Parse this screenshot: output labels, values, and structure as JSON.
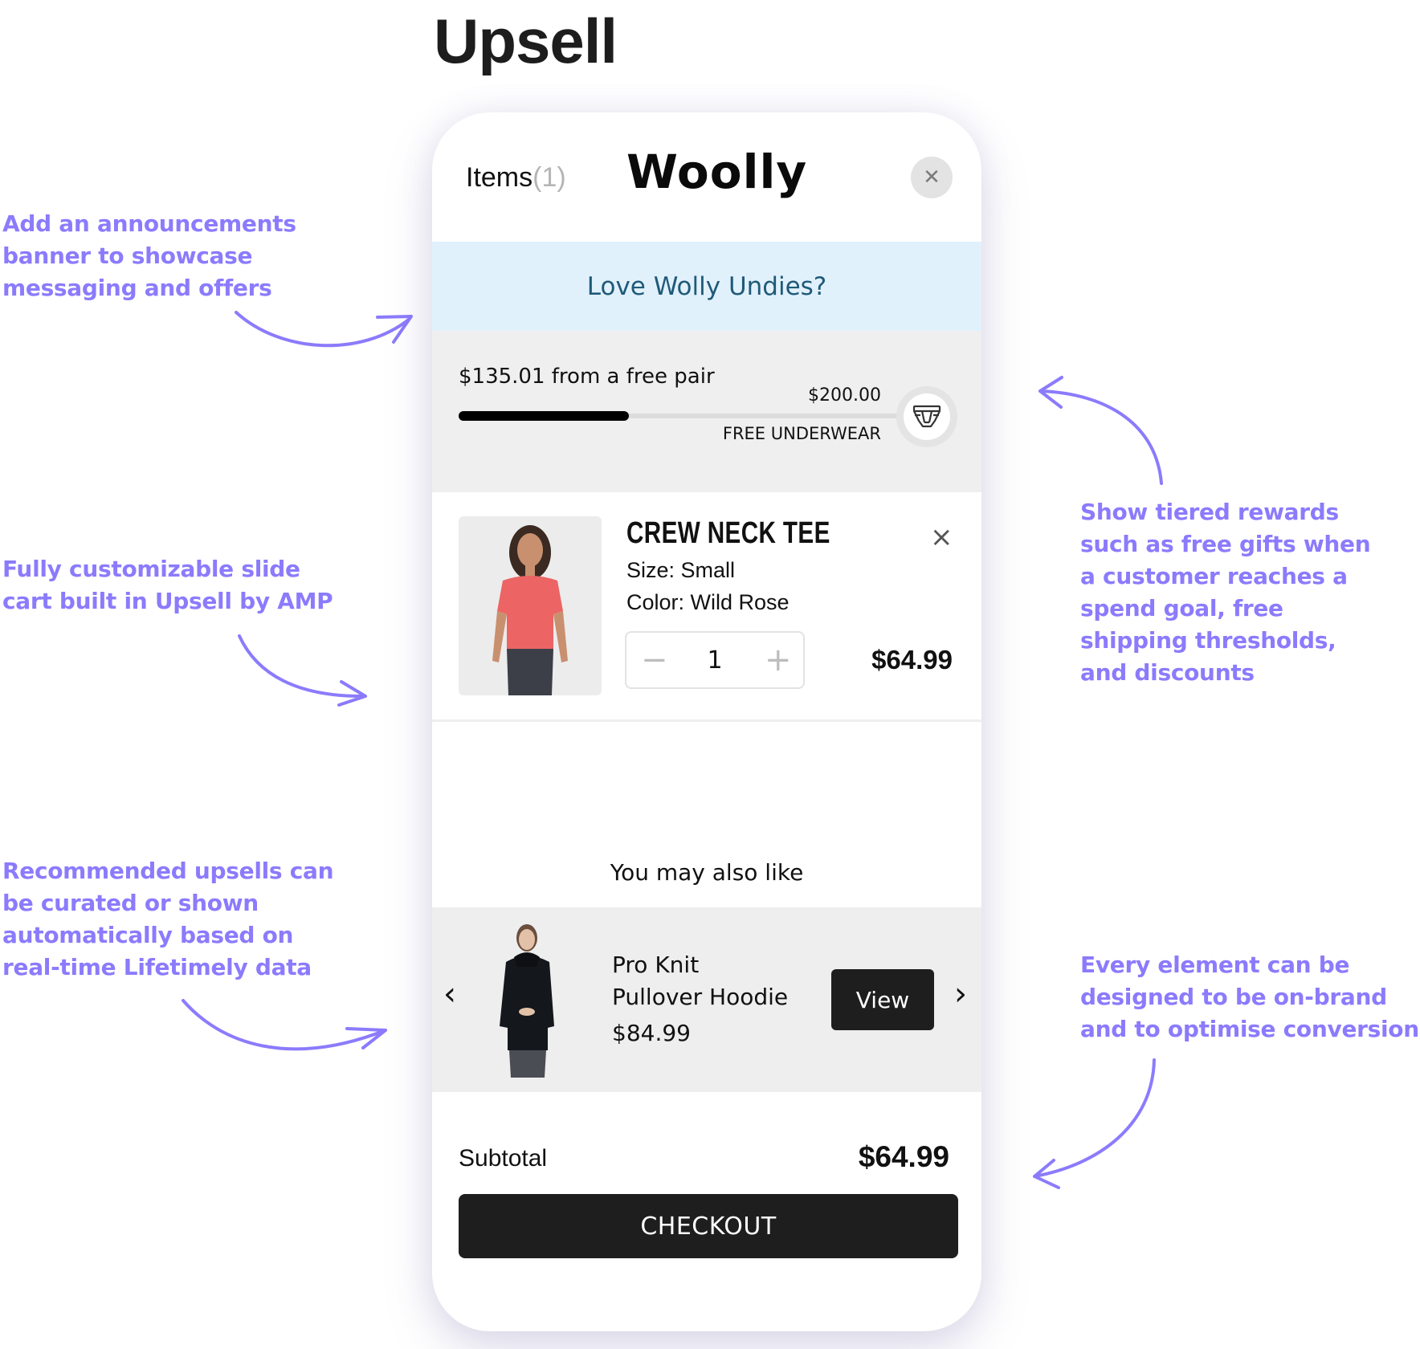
{
  "page": {
    "title": "Upsell"
  },
  "annotations": [
    {
      "id": "announcements",
      "lines": [
        "Add an announcements",
        "banner to showcase",
        "messaging and offers"
      ]
    },
    {
      "id": "slide-cart",
      "lines": [
        "Fully customizable slide",
        "cart built in Upsell by AMP"
      ]
    },
    {
      "id": "upsells",
      "lines": [
        "Recommended upsells can",
        "be curated or shown",
        "automatically based on",
        "real-time Lifetimely data"
      ]
    },
    {
      "id": "tiered-rewards",
      "lines": [
        "Show tiered rewards",
        "such as free gifts when",
        "a customer reaches a",
        "spend goal, free",
        "shipping thresholds,",
        "and discounts"
      ]
    },
    {
      "id": "on-brand",
      "lines": [
        "Every element can be",
        "designed to be on-brand",
        "and to optimise conversion"
      ]
    }
  ],
  "colors": {
    "annotation": "#8b7bfc",
    "banner_bg": "#e1f1fc",
    "banner_text": "#1f5a78",
    "button_dark": "#1e1e1e"
  },
  "cart": {
    "header": {
      "items_label": "Items",
      "items_count": "(1)",
      "brand": "Woolly",
      "close_icon": "close-icon"
    },
    "announcement": {
      "text": "Love Wolly Undies?"
    },
    "rewards": {
      "message": "$135.01 from a free pair",
      "goal": "$200.00",
      "reward_label": "FREE UNDERWEAR",
      "progress_fraction": 0.325,
      "icon": "underwear-icon"
    },
    "line_item": {
      "title": "CREW NECK TEE",
      "size": "Size: Small",
      "color": "Color: Wild Rose",
      "quantity": "1",
      "decrement": "−",
      "increment": "+",
      "price": "$64.99",
      "remove_icon": "×"
    },
    "recommendations": {
      "heading": "You may also like",
      "prev_icon": "‹",
      "next_icon": "›",
      "item": {
        "name_line1": "Pro Knit",
        "name_line2": "Pullover Hoodie",
        "price": "$84.99",
        "button": "View"
      }
    },
    "footer": {
      "subtotal_label": "Subtotal",
      "subtotal_value": "$64.99",
      "checkout": "CHECKOUT"
    }
  }
}
